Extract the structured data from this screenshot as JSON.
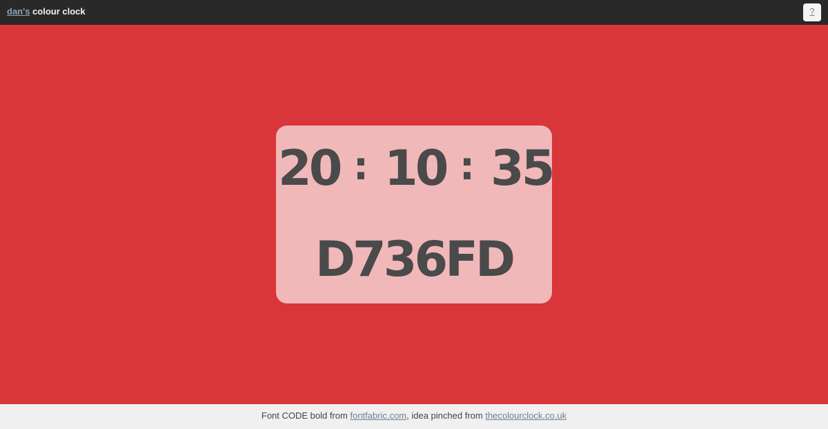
{
  "header": {
    "brand_link": "dan's",
    "brand_rest": " colour clock",
    "help_label": "?"
  },
  "clock": {
    "hours": "20",
    "minutes": "10",
    "seconds": "35",
    "separator": ":",
    "hex": "D736FD"
  },
  "footer": {
    "text_1": "Font CODE bold from ",
    "link_1": "fontfabric.com",
    "text_2": ", idea pinched from ",
    "link_2": "thecolourclock.co.uk"
  },
  "colors": {
    "background": "#d83639",
    "topbar": "#292929",
    "footer": "#f0f0f0",
    "card": "#f0b8ba",
    "digits": "#4a4a4a",
    "link": "#6b7f95"
  }
}
